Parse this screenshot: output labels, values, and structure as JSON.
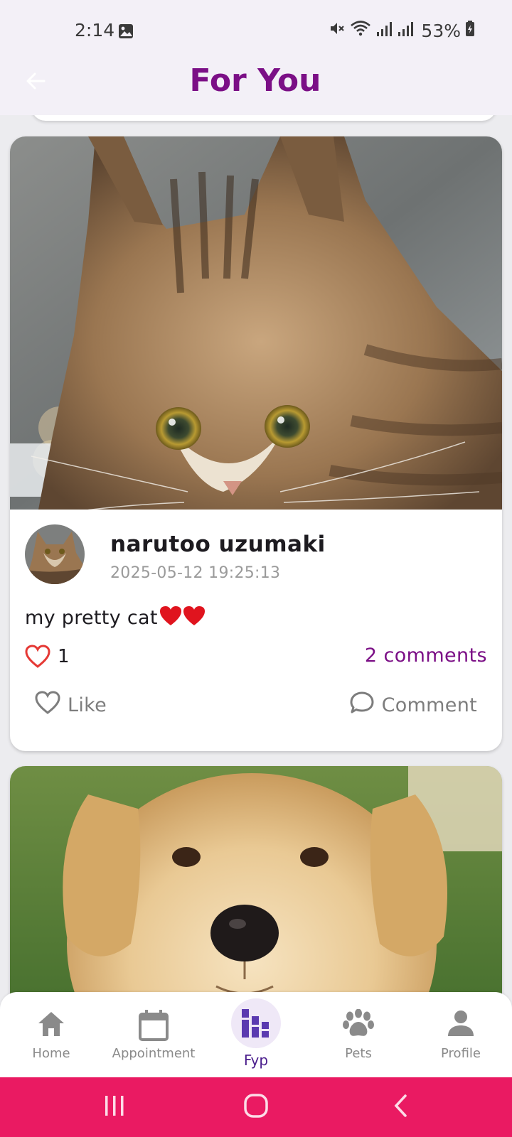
{
  "status_bar": {
    "time": "2:14",
    "battery": "53%"
  },
  "app_bar": {
    "title": "For You",
    "title_color": "#7b0f86"
  },
  "feed": {
    "posts": [
      {
        "author": "narutoo uzumaki",
        "timestamp": "2025-05-12 19:25:13",
        "caption": "my pretty cat",
        "likes": "1",
        "comments": "2 comments",
        "like_label": "Like",
        "comment_label": "Comment"
      }
    ]
  },
  "bottom_nav": {
    "items": [
      {
        "label": "Home",
        "icon": "home-icon"
      },
      {
        "label": "Appointment",
        "icon": "calendar-icon"
      },
      {
        "label": "Fyp",
        "icon": "fyp-icon",
        "active": true
      },
      {
        "label": "Pets",
        "icon": "paw-icon"
      },
      {
        "label": "Profile",
        "icon": "person-icon"
      }
    ]
  },
  "colors": {
    "accent": "#7b0f86",
    "nav_active": "#4a1d8c",
    "system_bar": "#ea1a62",
    "heart": "#e53935"
  }
}
